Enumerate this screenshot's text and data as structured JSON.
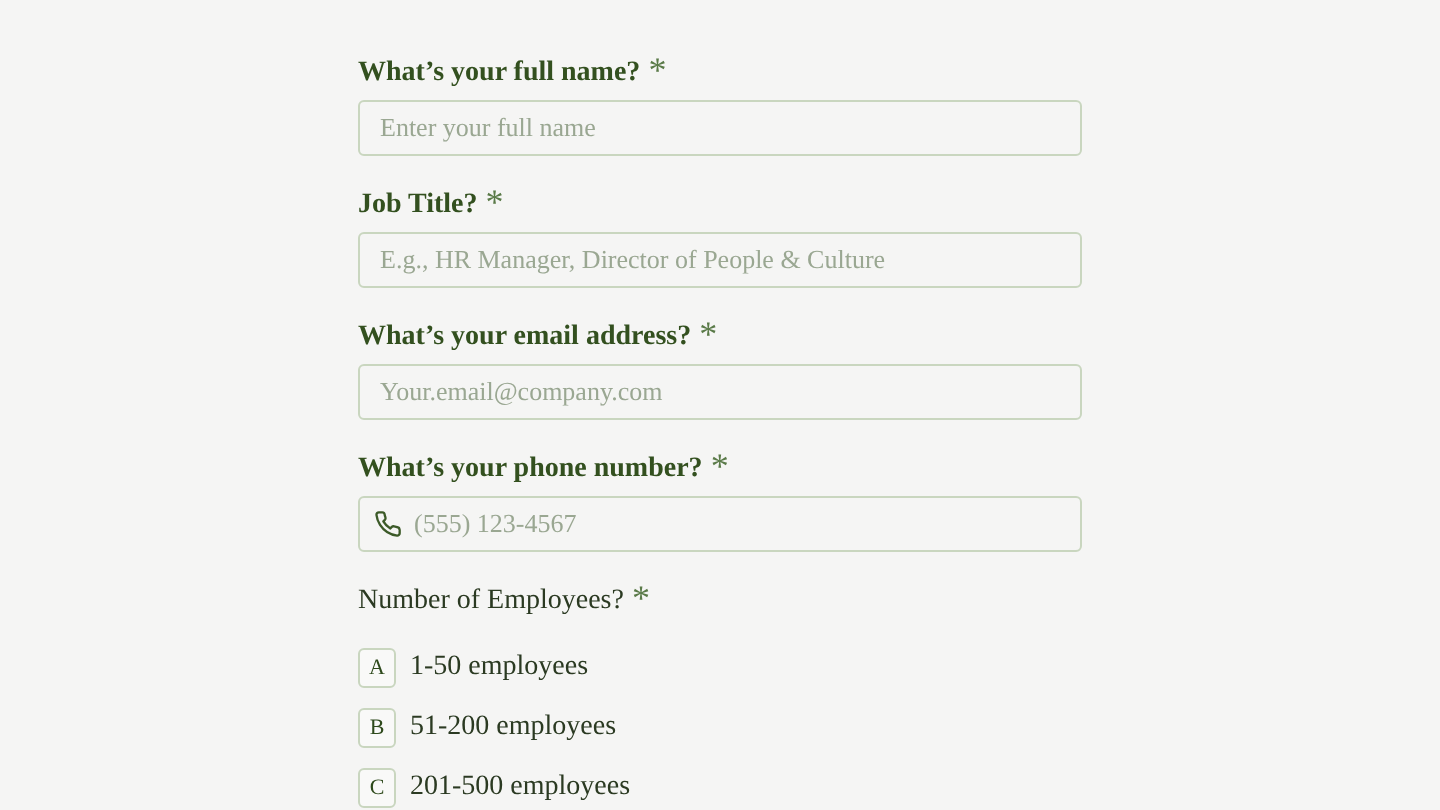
{
  "fields": [
    {
      "label": "What’s your full name?",
      "mark": "*",
      "placeholder": "Enter your full name"
    },
    {
      "label": "Job Title?",
      "mark": "*",
      "placeholder": "E.g., HR Manager, Director of People & Culture"
    },
    {
      "label": "What’s your email address?",
      "mark": "*",
      "placeholder": "Your.email@company.com"
    },
    {
      "label": "What’s your phone number?",
      "mark": "*",
      "placeholder": "(555) 123-4567",
      "kind": "phone"
    }
  ],
  "choice": {
    "label": "Number of Employees?",
    "mark": "*",
    "options": [
      {
        "key": "A",
        "label": "1-50 employees"
      },
      {
        "key": "B",
        "label": "51-200 employees"
      },
      {
        "key": "C",
        "label": "201-500 employees"
      }
    ]
  }
}
